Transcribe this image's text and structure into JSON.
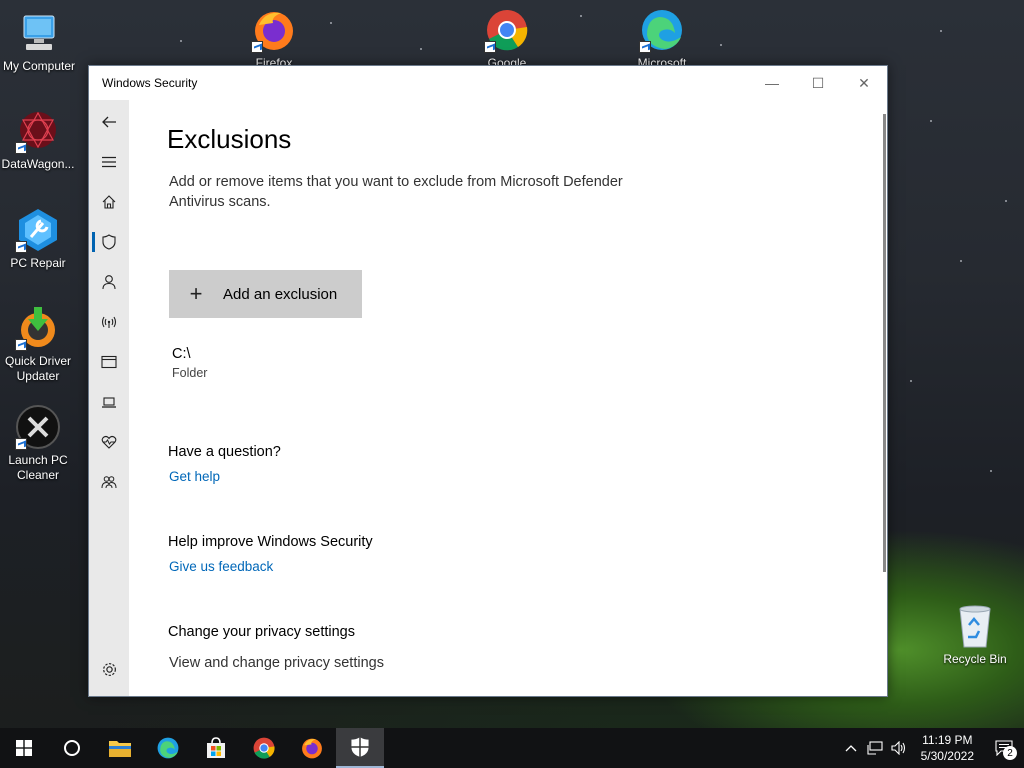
{
  "desktop": {
    "icons_left": [
      {
        "label": "My Computer",
        "icon": "computer-icon"
      },
      {
        "label": "DataWagon...",
        "icon": "datawagon-icon"
      },
      {
        "label": "PC Repair",
        "icon": "pc-repair-icon"
      },
      {
        "label": "Quick Driver Updater",
        "icon": "driver-updater-icon"
      },
      {
        "label": "Launch PC Cleaner",
        "icon": "pc-cleaner-icon"
      }
    ],
    "icons_top": [
      {
        "label": "Firefox",
        "icon": "firefox-icon"
      },
      {
        "label": "Google",
        "icon": "chrome-icon"
      },
      {
        "label": "Microsoft",
        "icon": "edge-icon"
      }
    ],
    "recycle_bin": {
      "label": "Recycle Bin",
      "icon": "recycle-bin-icon"
    }
  },
  "window": {
    "title": "Windows Security",
    "minimize": "—",
    "maximize": "☐",
    "close": "✕"
  },
  "sidebar": {
    "items": [
      {
        "name": "back",
        "icon": "back-arrow-icon"
      },
      {
        "name": "menu",
        "icon": "hamburger-icon"
      },
      {
        "name": "home",
        "icon": "home-icon"
      },
      {
        "name": "virus-protection",
        "icon": "shield-icon",
        "active": true
      },
      {
        "name": "account-protection",
        "icon": "person-icon"
      },
      {
        "name": "firewall",
        "icon": "wireless-icon"
      },
      {
        "name": "app-browser-control",
        "icon": "browser-window-icon"
      },
      {
        "name": "device-security",
        "icon": "laptop-icon"
      },
      {
        "name": "device-performance",
        "icon": "heart-pulse-icon"
      },
      {
        "name": "family-options",
        "icon": "family-icon"
      },
      {
        "name": "settings",
        "icon": "gear-icon"
      }
    ]
  },
  "main": {
    "title": "Exclusions",
    "description": "Add or remove items that you want to exclude from Microsoft Defender Antivirus scans.",
    "add_button": {
      "icon": "+",
      "label": "Add an exclusion"
    },
    "exclusions": [
      {
        "path": "C:\\",
        "type": "Folder"
      }
    ],
    "question": {
      "heading": "Have a question?",
      "link": "Get help"
    },
    "improve": {
      "heading": "Help improve Windows Security",
      "link": "Give us feedback"
    },
    "privacy": {
      "heading": "Change your privacy settings",
      "link": "View and change privacy settings"
    }
  },
  "taskbar": {
    "items": [
      {
        "name": "start",
        "icon": "windows-logo-icon"
      },
      {
        "name": "search",
        "icon": "cortana-circle-icon"
      },
      {
        "name": "file-explorer",
        "icon": "folder-icon"
      },
      {
        "name": "edge",
        "icon": "edge-icon"
      },
      {
        "name": "store",
        "icon": "store-icon"
      },
      {
        "name": "chrome",
        "icon": "chrome-icon"
      },
      {
        "name": "firefox",
        "icon": "firefox-icon"
      },
      {
        "name": "windows-security",
        "icon": "shield-icon",
        "active": true
      }
    ],
    "clock": {
      "time": "11:19 PM",
      "date": "5/30/2022"
    },
    "notifications": "2"
  },
  "colors": {
    "accent": "#0063b1",
    "link": "#0067b8",
    "button_bg": "#cccccc",
    "sidebar_bg": "#e9e9e9",
    "taskbar_bg": "#111214"
  }
}
